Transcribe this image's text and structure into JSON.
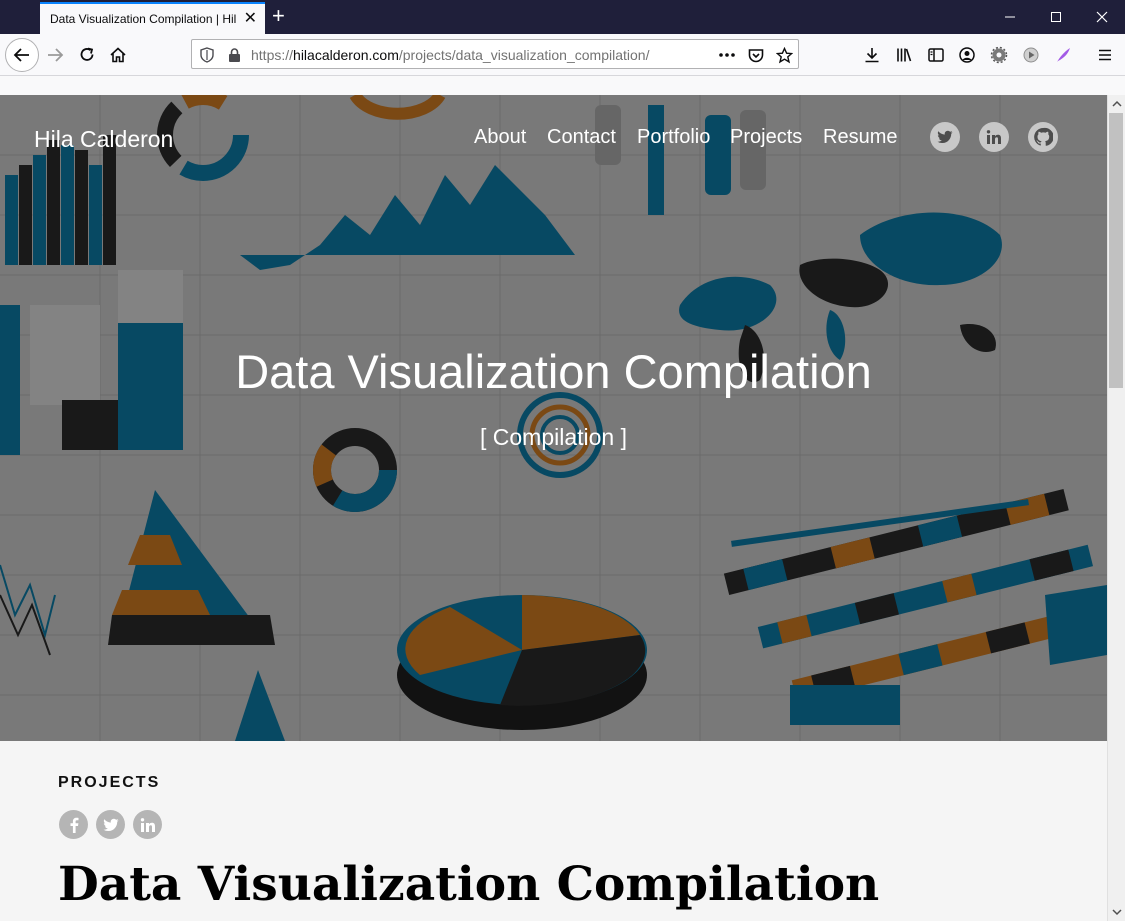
{
  "browser": {
    "tab_title": "Data Visualization Compilation | Hila Calderon",
    "url_prefix": "https://",
    "url_domain": "hilacalderon.com",
    "url_path": "/projects/data_visualization_compilation/",
    "accent_color": "#0a84ff"
  },
  "site": {
    "name": "Hila Calderon",
    "nav": [
      "About",
      "Contact",
      "Portfolio",
      "Projects",
      "Resume"
    ],
    "social_icons": [
      "twitter-icon",
      "linkedin-icon",
      "github-icon"
    ]
  },
  "hero": {
    "title": "Data Visualization Compilation",
    "subtitle": "[ Compilation ]"
  },
  "article": {
    "section": "PROJECTS",
    "share_icons": [
      "facebook-icon",
      "twitter-icon",
      "linkedin-icon"
    ],
    "title": "Data Visualization Compilation"
  },
  "colors": {
    "infographic_blue": "#0e86b4",
    "infographic_orange": "#e08526",
    "infographic_dark": "#2e2e2e"
  }
}
